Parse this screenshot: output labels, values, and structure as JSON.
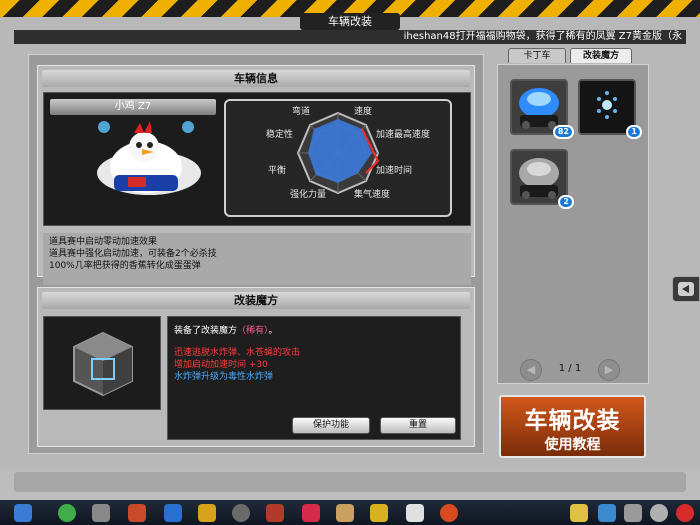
{
  "window": {
    "title": "车辆改装",
    "ticker": "iheshan48打开福福购物袋，获得了稀有的凤翼 Z7黄金版（永"
  },
  "car_info": {
    "header": "车辆信息",
    "car_name": "小鸡 Z7",
    "radar_labels": [
      "弯道",
      "速度",
      "稳定性",
      "加速最高速度",
      "平衡",
      "加速时间",
      "强化力量",
      "集气速度"
    ],
    "description": [
      "道具赛中启动零动加速效果",
      "道具赛中强化启动加速，可装备2个必杀技",
      "100%几率把获得的香蕉转化成蛋蛋弹"
    ]
  },
  "modify_magic": {
    "header": "改装魔方",
    "equipped_prefix": "装备了改装魔方",
    "equipped_name": "（稀有）",
    "equipped_suffix": "。",
    "effects_red": [
      "迅速逃脱水炸弹、水苍蝇的攻击",
      "增加启动加速时间 +30"
    ],
    "effect_blue": "水炸弹升级为毒性水炸弹",
    "protect_button": "保护功能",
    "reset_button": "重置"
  },
  "inventory": {
    "tabs": [
      "卡丁车",
      "改装魔方"
    ],
    "active_tab": 1,
    "slots": [
      {
        "count": "82"
      },
      {
        "count": "1"
      },
      {
        "count": "2"
      }
    ],
    "page": "1 / 1"
  },
  "tutorial": {
    "title": "车辆改装",
    "subtitle": "使用教程"
  },
  "colors": {
    "accent_red": "#ff3a3a",
    "accent_blue": "#4aaaff",
    "highlight_pink": "#ff5a8a",
    "tutorial_orange": "#d2581c"
  }
}
